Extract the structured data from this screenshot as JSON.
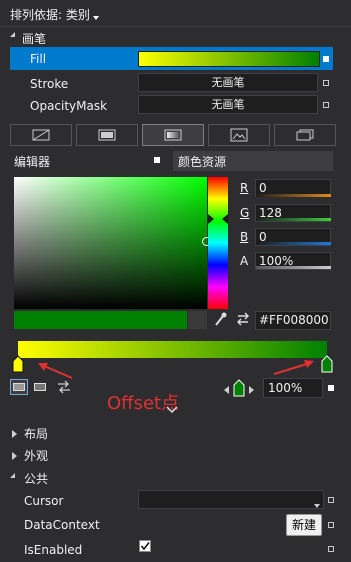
{
  "header": {
    "sort_label": "排列依据: 类别"
  },
  "brush_section": {
    "title": "画笔"
  },
  "brush_rows": [
    {
      "label": "Fill",
      "value": ""
    },
    {
      "label": "Stroke",
      "value": "无画笔"
    },
    {
      "label": "OpacityMask",
      "value": "无画笔"
    }
  ],
  "brush_tabs": [
    "null-brush",
    "solid-brush",
    "gradient-brush",
    "image-brush",
    "resource-brush"
  ],
  "panel_tabs": {
    "editor": "编辑器",
    "color_resources": "颜色资源"
  },
  "channels": [
    {
      "label": "R",
      "value": "0",
      "color": "#e08a1e"
    },
    {
      "label": "G",
      "value": "128",
      "color": "#3cd03c"
    },
    {
      "label": "B",
      "value": "0",
      "color": "#1e7ae0"
    },
    {
      "label": "A",
      "value": "100%",
      "color": "#cccccc"
    }
  ],
  "color": {
    "hex": "#FF008000",
    "current": "#008000",
    "gradient_start": "#ffff00",
    "gradient_end": "#008000"
  },
  "gradient_stops": [
    {
      "offset": 0,
      "color": "#ffff00"
    },
    {
      "offset": 1,
      "color": "#008000"
    }
  ],
  "offset": {
    "value": "100%"
  },
  "annotation": {
    "text": "Offset点",
    "color": "#e03030"
  },
  "sections": [
    {
      "label": "布局"
    },
    {
      "label": "外观"
    },
    {
      "label": "公共"
    }
  ],
  "common_rows": {
    "cursor": {
      "label": "Cursor",
      "value": ""
    },
    "datacontext": {
      "label": "DataContext",
      "button": "新建"
    },
    "isenabled": {
      "label": "IsEnabled",
      "checked": true
    }
  }
}
